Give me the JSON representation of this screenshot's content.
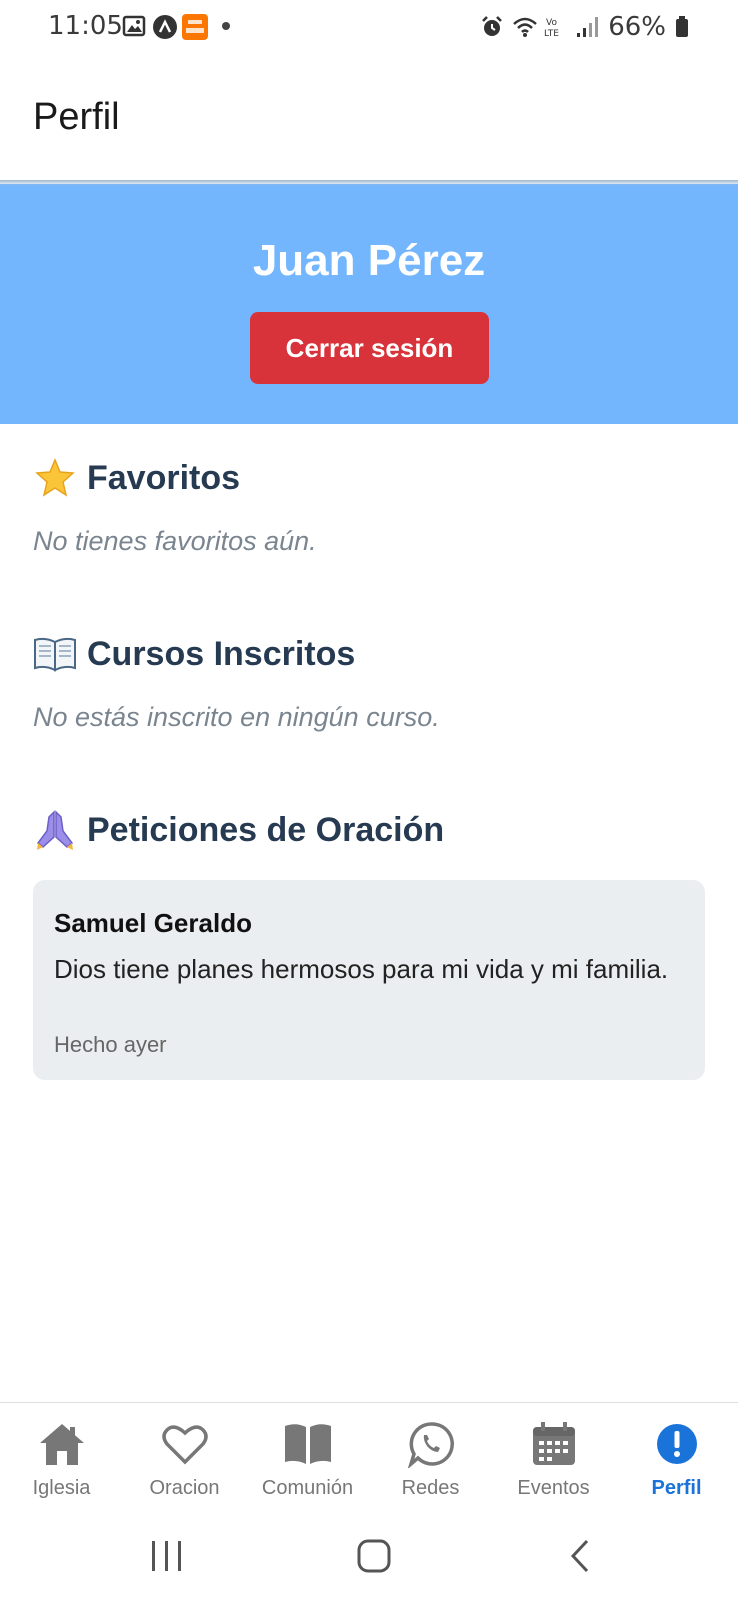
{
  "status_bar": {
    "time": "11:05",
    "battery": "66%",
    "icons": [
      "gallery-icon",
      "arc-icon",
      "temu-icon",
      "alarm-icon",
      "wifi-icon",
      "volte-icon",
      "signal-icon",
      "battery-icon"
    ]
  },
  "header": {
    "title": "Perfil"
  },
  "profile": {
    "name": "Juan Pérez",
    "logout_label": "Cerrar sesión"
  },
  "sections": {
    "favorites": {
      "icon": "star-icon",
      "title": "Favoritos",
      "empty_text": "No tienes favoritos aún."
    },
    "courses": {
      "icon": "book-icon",
      "title": "Cursos Inscritos",
      "empty_text": "No estás inscrito en ningún curso."
    },
    "prayers": {
      "icon": "praying-hands-icon",
      "title": "Peticiones de Oración",
      "items": [
        {
          "name": "Samuel Geraldo",
          "text": "Dios tiene planes hermosos para mi vida y mi familia.",
          "time": "Hecho ayer"
        }
      ]
    }
  },
  "bottom_nav": {
    "items": [
      {
        "label": "Iglesia",
        "icon": "home-icon"
      },
      {
        "label": "Oracion",
        "icon": "heart-icon"
      },
      {
        "label": "Comunión",
        "icon": "book-open-icon"
      },
      {
        "label": "Redes",
        "icon": "whatsapp-icon"
      },
      {
        "label": "Eventos",
        "icon": "calendar-icon"
      },
      {
        "label": "Perfil",
        "icon": "alert-circle-icon",
        "active": true
      }
    ],
    "active_color": "#1a73d9",
    "inactive_color": "#777777"
  },
  "colors": {
    "banner": "#74b6fd",
    "logout_button": "#d8333a",
    "section_title": "#263a52",
    "card_background": "#ebeef0"
  }
}
